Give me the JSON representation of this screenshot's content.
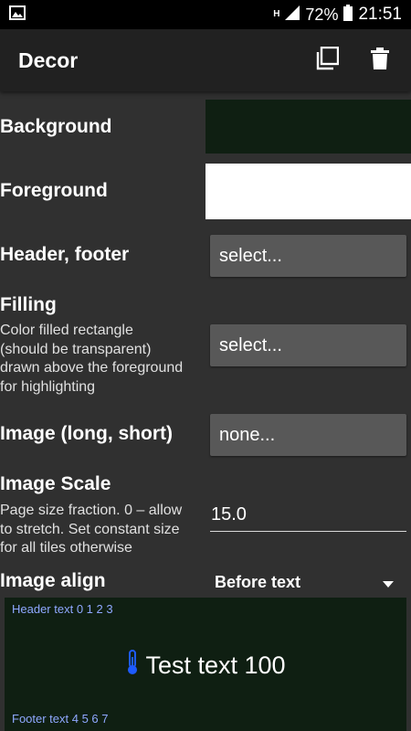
{
  "status_bar": {
    "battery": "72%",
    "time": "21:51",
    "network": "H"
  },
  "app_bar": {
    "title": "Decor",
    "copy_icon": "copy-icon",
    "delete_icon": "trash-icon"
  },
  "settings": {
    "background": {
      "label": "Background",
      "color": "#0f1f12"
    },
    "foreground": {
      "label": "Foreground",
      "color": "#ffffff"
    },
    "header_footer": {
      "label": "Header, footer",
      "value": "select..."
    },
    "filling": {
      "label": "Filling",
      "description": [
        "Color filled rectangle",
        "(should be transparent)",
        "drawn above the foreground",
        "for highlighting"
      ],
      "value": "select..."
    },
    "image": {
      "label": "Image (long, short)",
      "value": "none..."
    },
    "image_scale": {
      "label": "Image Scale",
      "description": [
        "Page size fraction. 0 – allow",
        "to stretch. Set constant size",
        "for all tiles otherwise"
      ],
      "value": "15.0"
    },
    "image_align": {
      "label": "Image align",
      "value": "Before text"
    }
  },
  "preview": {
    "header_text": "Header text 0 1 2 3",
    "main_text": "Test text 100",
    "footer_text": "Footer text 4 5 6 7",
    "background": "#0f1f12",
    "header_footer_color": "#8fa8ff",
    "icon": "thermometer-icon"
  }
}
